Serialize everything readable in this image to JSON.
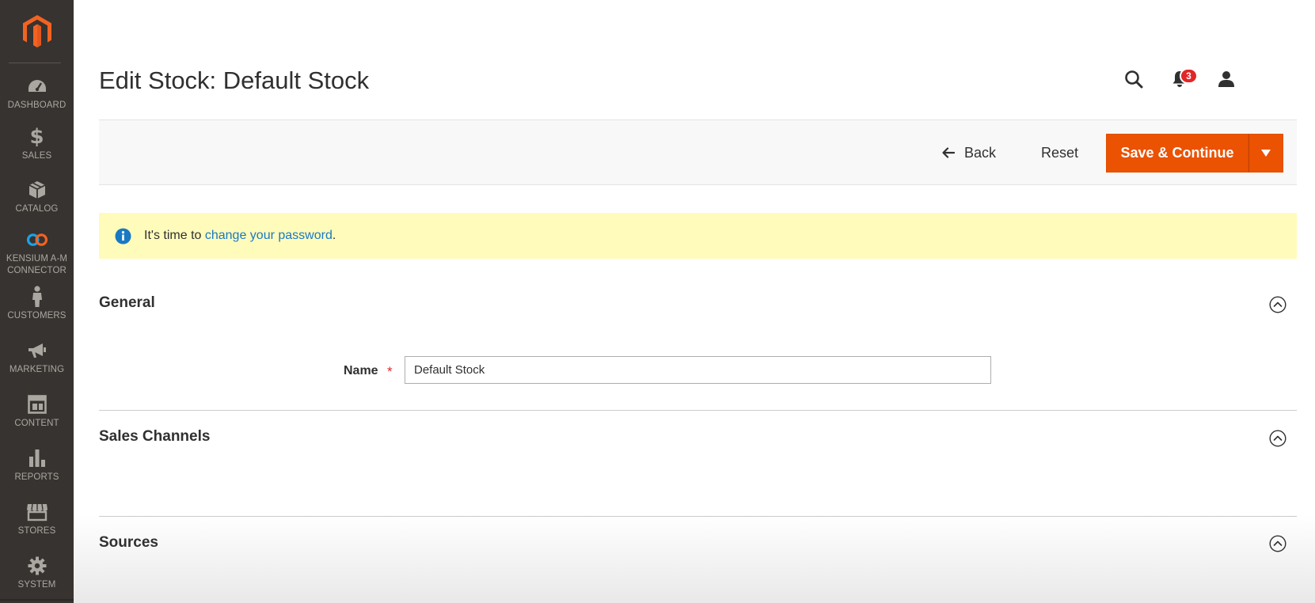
{
  "sidebar": {
    "items": [
      {
        "label": "DASHBOARD",
        "icon": "dashboard-icon"
      },
      {
        "label": "SALES",
        "icon": "dollar-icon"
      },
      {
        "label": "CATALOG",
        "icon": "cube-icon"
      },
      {
        "label": "KENSIUM A-M CONNECTOR",
        "icon": "kensium-logo-icon"
      },
      {
        "label": "CUSTOMERS",
        "icon": "person-icon"
      },
      {
        "label": "MARKETING",
        "icon": "megaphone-icon"
      },
      {
        "label": "CONTENT",
        "icon": "layout-icon"
      },
      {
        "label": "REPORTS",
        "icon": "bar-chart-icon"
      },
      {
        "label": "STORES",
        "icon": "storefront-icon"
      },
      {
        "label": "SYSTEM",
        "icon": "gear-icon"
      }
    ]
  },
  "header": {
    "title": "Edit Stock: Default Stock",
    "notification_count": "3"
  },
  "toolbar": {
    "back_label": "Back",
    "reset_label": "Reset",
    "save_label": "Save & Continue"
  },
  "message": {
    "prefix": "It's time to ",
    "link": "change your password",
    "suffix": "."
  },
  "sections": {
    "general": {
      "title": "General"
    },
    "sales_channels": {
      "title": "Sales Channels"
    },
    "sources": {
      "title": "Sources"
    }
  },
  "form": {
    "name_label": "Name",
    "name_value": "Default Stock"
  },
  "colors": {
    "sidebar": "#373330",
    "accent": "#eb5202",
    "message_bg": "#fffbbb",
    "link": "#1979c3"
  }
}
